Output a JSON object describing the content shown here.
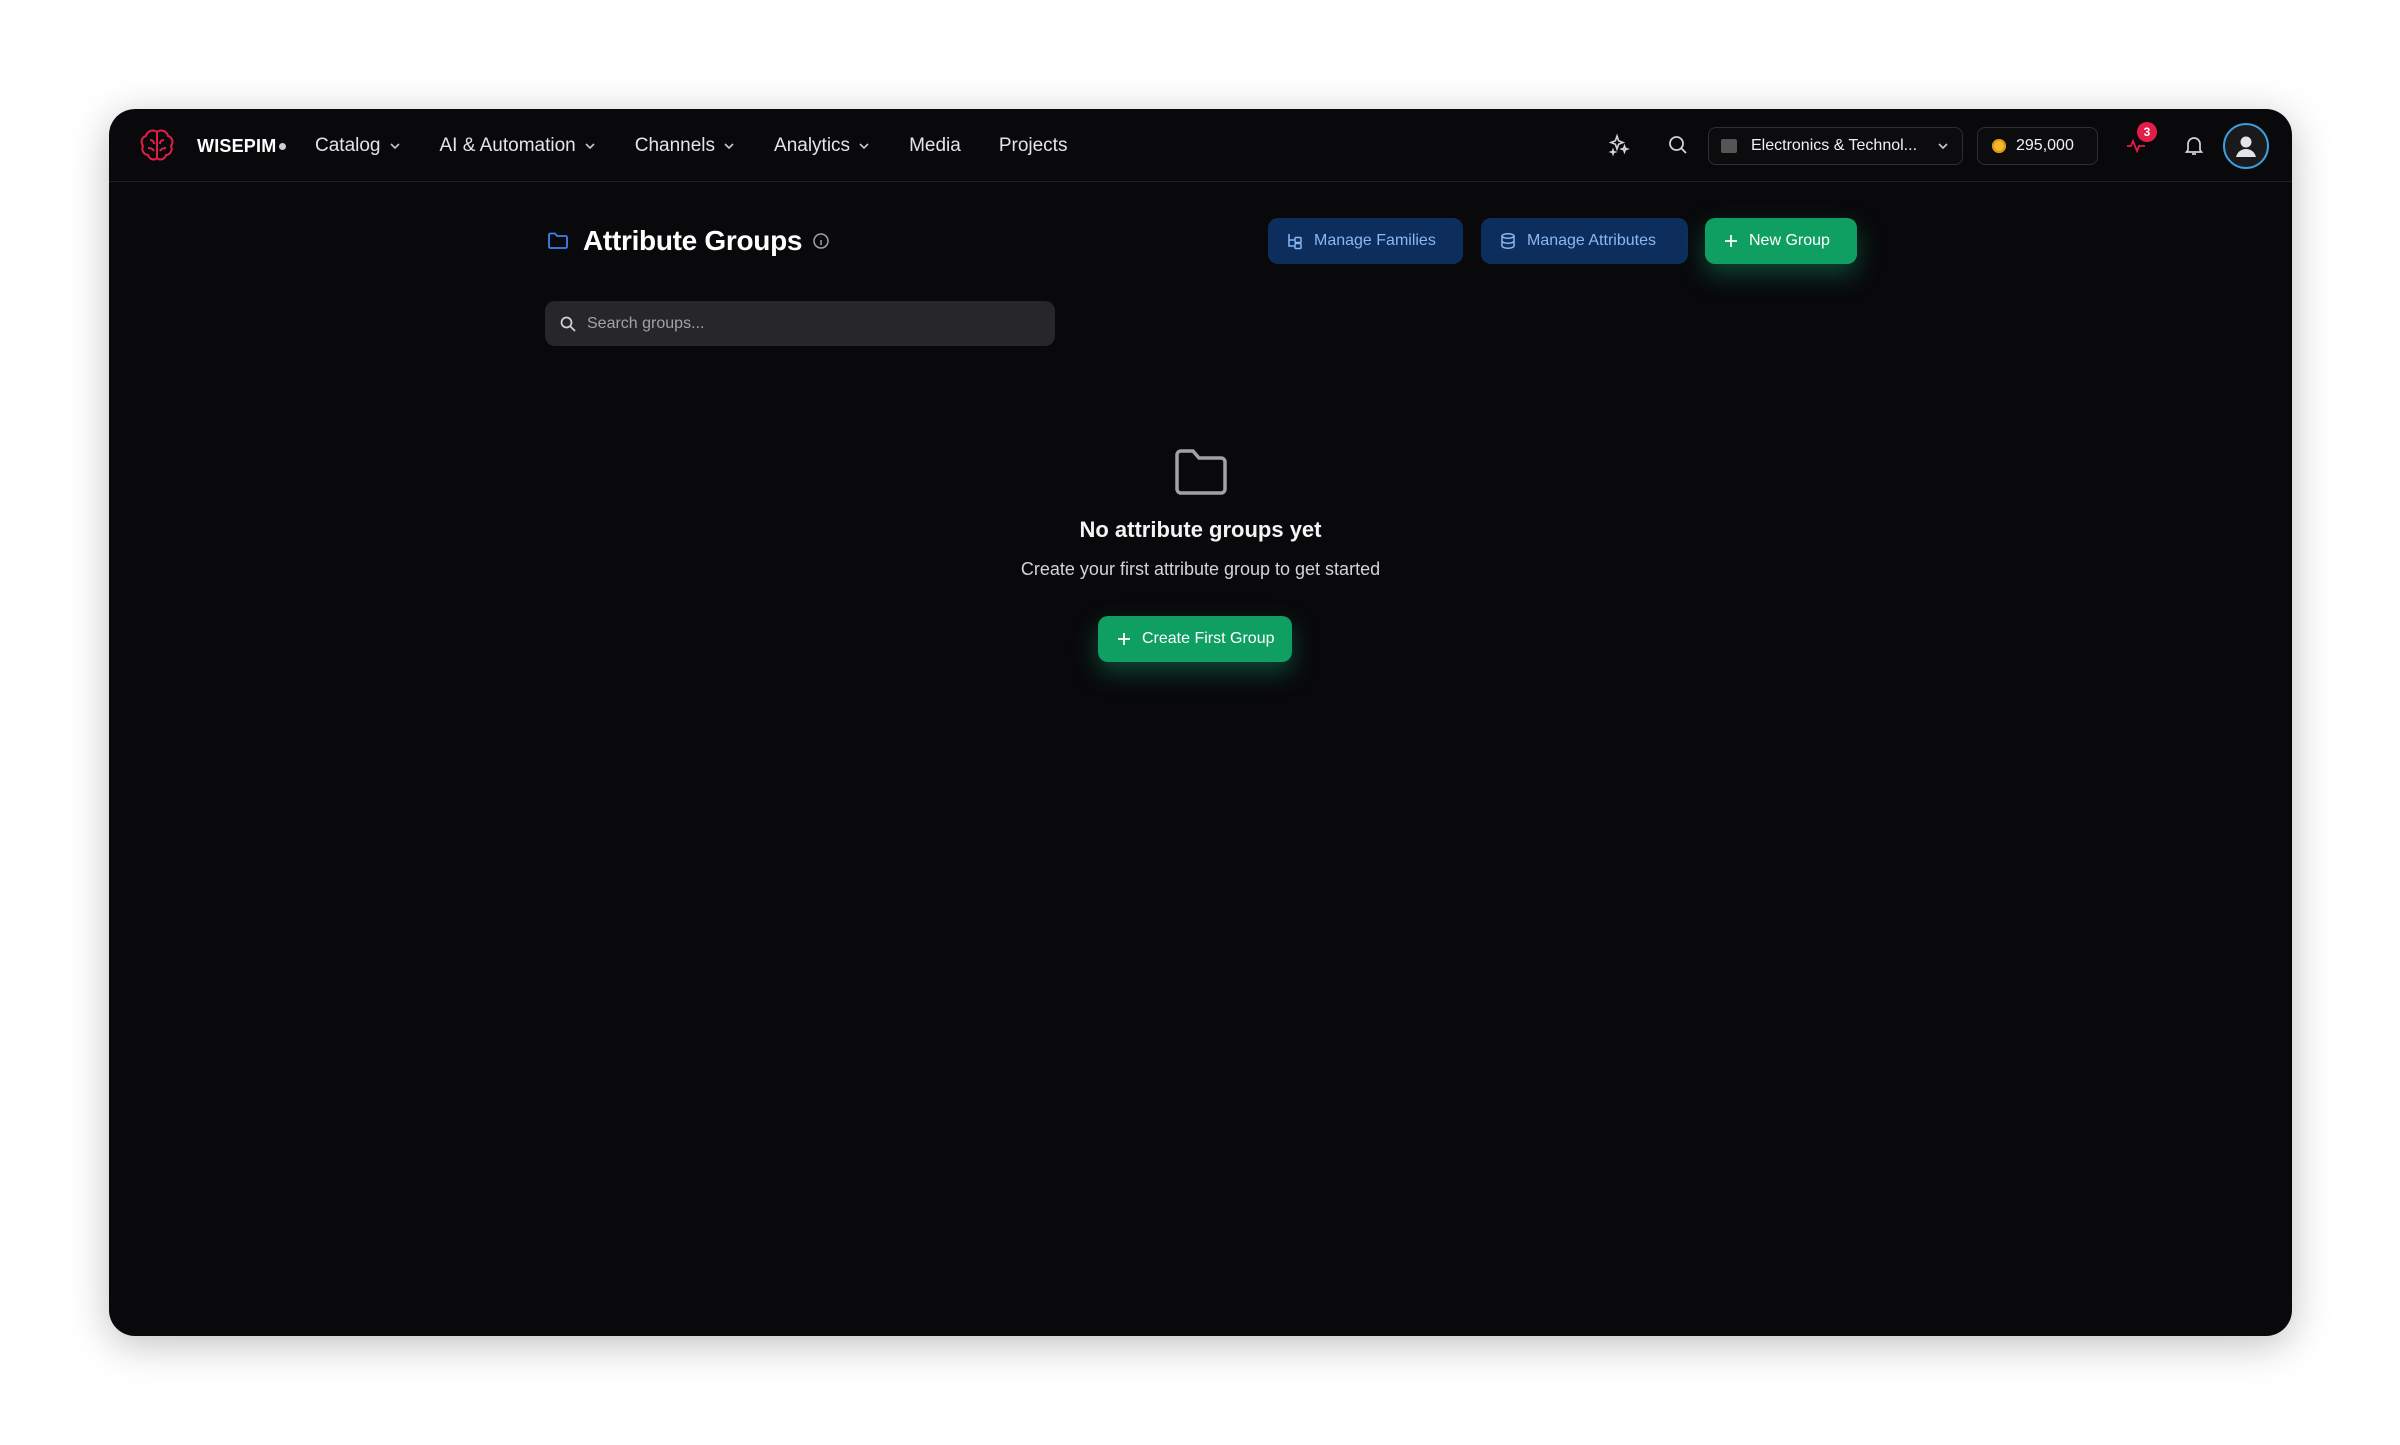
{
  "brand": {
    "name": "WISEPIM",
    "logo_icon": "brain-logo-icon",
    "accent": "#e11d48"
  },
  "nav": {
    "items": [
      {
        "label": "Catalog",
        "has_dropdown": true
      },
      {
        "label": "AI & Automation",
        "has_dropdown": true
      },
      {
        "label": "Channels",
        "has_dropdown": true
      },
      {
        "label": "Analytics",
        "has_dropdown": true
      },
      {
        "label": "Media",
        "has_dropdown": false
      },
      {
        "label": "Projects",
        "has_dropdown": false
      }
    ]
  },
  "toolbar": {
    "workspace_label": "Electronics & Technol...",
    "credits": "295,000",
    "activity_badge": "3"
  },
  "page": {
    "title": "Attribute Groups",
    "manage_families_label": "Manage Families",
    "manage_attributes_label": "Manage Attributes",
    "new_group_label": "New Group"
  },
  "search": {
    "placeholder": "Search groups..."
  },
  "empty_state": {
    "title": "No attribute groups yet",
    "subtitle": "Create your first attribute group to get started",
    "cta_label": "Create First Group"
  },
  "colors": {
    "background": "#09090b",
    "primary_green": "#0f9f63",
    "blue_button": "#0d2e5c",
    "blue_text": "#8ab8f5"
  }
}
